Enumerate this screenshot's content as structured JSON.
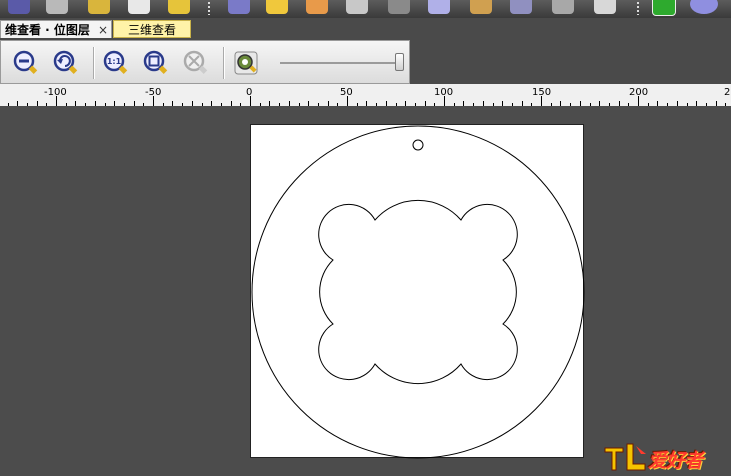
{
  "tabs": [
    {
      "label": "维查看 · 位图层",
      "close": "×",
      "active": true
    },
    {
      "label": "三维查看",
      "active": false
    }
  ],
  "toolbar_icons": [
    "star-icon",
    "refresh-icon",
    "gear-icon",
    "layers-icon",
    "folder-icon",
    "shield-icon",
    "warning-icon",
    "globe-icon",
    "tools-icon",
    "print-icon",
    "window-icon",
    "settings-icon",
    "triangle-icon",
    "stack-icon",
    "cube-icon",
    "green-button-icon",
    "sphere-icon"
  ],
  "view_toolbar": {
    "buttons": [
      "zoom-out-icon",
      "undo-zoom-icon",
      "actual-size-icon",
      "fit-window-icon",
      "zoom-selection-icon",
      "render-icon"
    ],
    "zoom_slider": {
      "value": 0.95
    }
  },
  "ruler": {
    "labels": [
      "-100",
      "-50",
      "0",
      "50",
      "100",
      "150",
      "200",
      "2"
    ]
  },
  "watermark": {
    "text": "爱好者"
  },
  "colors": {
    "canvas_bg": "#4c4c4c",
    "sheet": "#ffffff",
    "outline": "#000000",
    "tab_active_bg": "#f4f4f4",
    "tab_3d_bg": "#fff3a8"
  }
}
